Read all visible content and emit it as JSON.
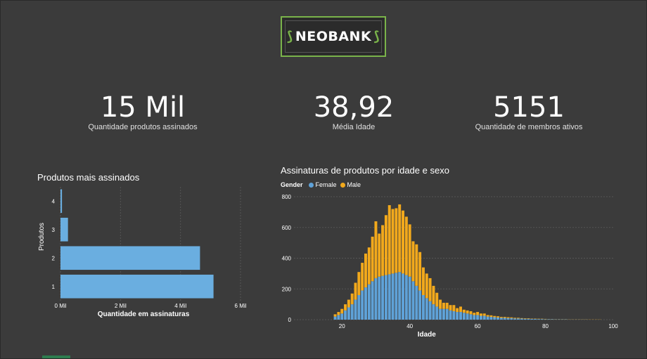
{
  "logo": {
    "text": "NEOBANK",
    "left_bracket": "⟆",
    "right_bracket": "⟆"
  },
  "kpis": [
    {
      "value": "15 Mil",
      "label": "Quantidade produtos assinados"
    },
    {
      "value": "38,92",
      "label": "Média Idade"
    },
    {
      "value": "5151",
      "label": "Quantidade de membros ativos"
    }
  ],
  "colors": {
    "female": "#5fa2d8",
    "male": "#f2a91c",
    "bar": "#6aaee0",
    "grid": "#555555"
  },
  "chart_data": [
    {
      "type": "bar",
      "orientation": "horizontal",
      "title": "Produtos mais assinados",
      "xlabel": "Quantidade em assinaturas",
      "ylabel": "Produtos",
      "categories": [
        "4",
        "3",
        "2",
        "1"
      ],
      "values": [
        0.05,
        0.25,
        4.65,
        5.1
      ],
      "xticks": [
        "0 Mil",
        "2 Mil",
        "4 Mil",
        "6 Mil"
      ],
      "xlim": [
        0,
        6
      ]
    },
    {
      "type": "bar",
      "stacked": true,
      "title": "Assinaturas de produtos por idade e sexo",
      "xlabel": "Idade",
      "ylabel": "",
      "legend_title": "Gender",
      "xlim": [
        10,
        100
      ],
      "ylim": [
        0,
        800
      ],
      "xticks": [
        "20",
        "40",
        "60",
        "80",
        "100"
      ],
      "yticks": [
        "0",
        "200",
        "400",
        "600",
        "800"
      ],
      "x": [
        18,
        19,
        20,
        21,
        22,
        23,
        24,
        25,
        26,
        27,
        28,
        29,
        30,
        31,
        32,
        33,
        34,
        35,
        36,
        37,
        38,
        39,
        40,
        41,
        42,
        43,
        44,
        45,
        46,
        47,
        48,
        49,
        50,
        51,
        52,
        53,
        54,
        55,
        56,
        57,
        58,
        59,
        60,
        61,
        62,
        63,
        64,
        65,
        66,
        67,
        68,
        69,
        70,
        71,
        72,
        73,
        74,
        75,
        76,
        77,
        78,
        79,
        80,
        81,
        82,
        83,
        84,
        85,
        86,
        87,
        88,
        89,
        90,
        91,
        92,
        93,
        94,
        95,
        96
      ],
      "series": [
        {
          "name": "Female",
          "values": [
            20,
            30,
            40,
            60,
            80,
            100,
            130,
            160,
            190,
            210,
            230,
            250,
            270,
            280,
            285,
            290,
            295,
            300,
            305,
            310,
            300,
            290,
            280,
            250,
            220,
            190,
            160,
            140,
            120,
            100,
            85,
            70,
            70,
            70,
            60,
            55,
            50,
            50,
            45,
            40,
            35,
            30,
            30,
            25,
            25,
            20,
            18,
            16,
            14,
            12,
            12,
            10,
            10,
            8,
            8,
            7,
            6,
            6,
            5,
            5,
            4,
            4,
            3,
            3,
            3,
            2,
            2,
            2,
            2,
            1,
            1,
            1,
            1,
            1,
            1,
            0,
            0,
            0,
            0
          ]
        },
        {
          "name": "Male",
          "values": [
            15,
            20,
            30,
            40,
            50,
            70,
            110,
            150,
            180,
            220,
            240,
            290,
            370,
            280,
            330,
            390,
            450,
            420,
            420,
            440,
            410,
            380,
            340,
            260,
            270,
            250,
            180,
            160,
            150,
            120,
            90,
            60,
            40,
            40,
            35,
            40,
            25,
            35,
            20,
            20,
            20,
            15,
            20,
            15,
            15,
            10,
            10,
            8,
            8,
            6,
            6,
            6,
            5,
            4,
            4,
            3,
            3,
            3,
            2,
            2,
            2,
            2,
            2,
            1,
            1,
            1,
            1,
            1,
            1,
            1,
            1,
            1,
            1,
            1,
            1,
            1,
            1,
            1,
            1
          ]
        }
      ]
    }
  ]
}
